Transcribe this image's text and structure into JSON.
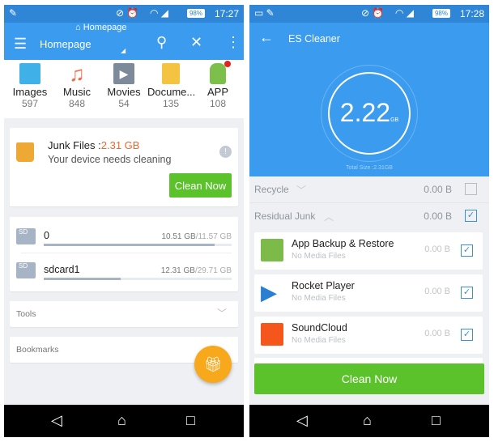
{
  "left": {
    "status": {
      "time": "17:27",
      "battery": "98%"
    },
    "tab_title": "Homepage",
    "toolbar": {
      "title": "Homepage",
      "icons": [
        "menu-icon",
        "search-icon",
        "close-icon",
        "more-vert-icon"
      ]
    },
    "categories": [
      {
        "label": "Images",
        "count": "597",
        "color": "#3fb0e8"
      },
      {
        "label": "Music",
        "count": "848",
        "color": "#f26b4a"
      },
      {
        "label": "Movies",
        "count": "54",
        "color": "#7d8a99"
      },
      {
        "label": "Docume...",
        "count": "135",
        "color": "#f5c342"
      },
      {
        "label": "APP",
        "count": "108",
        "color": "#7cc04b"
      }
    ],
    "junk": {
      "label": "Junk Files :",
      "size": "2.31 GB",
      "message": "Your device needs cleaning",
      "button": "Clean Now"
    },
    "storage": [
      {
        "name": "0",
        "used": "10.51 GB",
        "total": "/11.57 GB",
        "fraction": 0.91
      },
      {
        "name": "sdcard1",
        "used": "12.31 GB",
        "total": "/29.71 GB",
        "fraction": 0.41
      }
    ],
    "tools_label": "Tools",
    "bookmarks_label": "Bookmarks"
  },
  "right": {
    "status": {
      "time": "17:28",
      "battery": "98%"
    },
    "header": {
      "title": "ES Cleaner"
    },
    "gauge": {
      "value": "2.22",
      "unit": "GB",
      "total": "Total Size :2.31GB"
    },
    "sections": [
      {
        "label": "Recycle",
        "size": "0.00 B",
        "checked": false
      },
      {
        "label": "Residual Junk",
        "size": "0.00 B",
        "checked": true
      }
    ],
    "items": [
      {
        "name": "App Backup & Restore",
        "sub": "No Media Files",
        "size": "0.00 B",
        "color": "#7cbb4a"
      },
      {
        "name": "Rocket Player",
        "sub": "No Media Files",
        "size": "0.00 B",
        "color": "#2a7fd0"
      },
      {
        "name": "SoundCloud",
        "sub": "No Media Files",
        "size": "0.00 B",
        "color": "#f5561b"
      }
    ],
    "clean_button": "Clean Now"
  },
  "colors": {
    "accent": "#3a9bef",
    "green": "#5cc22c",
    "junk_size": "#f0672e",
    "fab": "#f7a81b"
  }
}
